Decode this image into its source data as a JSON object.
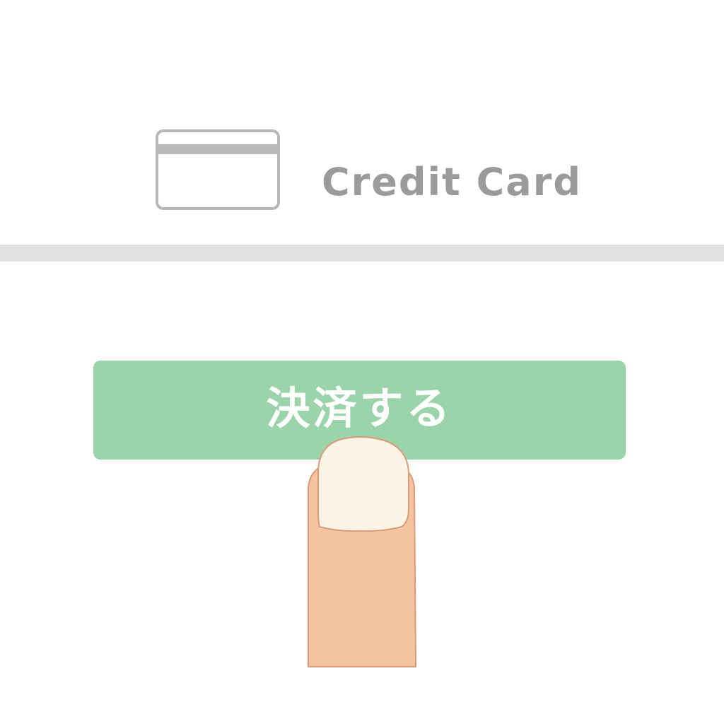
{
  "payment_option": {
    "icon": "credit-card-icon",
    "label": "Credit Card"
  },
  "pay_button": {
    "label": "決済する",
    "color": "#9bd4aa"
  },
  "pointer": {
    "icon": "finger-tap-icon",
    "skin_color": "#f4c4a2",
    "nail_color": "#fdf4e8"
  },
  "colors": {
    "background": "#ffffff",
    "divider": "#e2e2e2",
    "option_text": "#9b9b9b"
  }
}
